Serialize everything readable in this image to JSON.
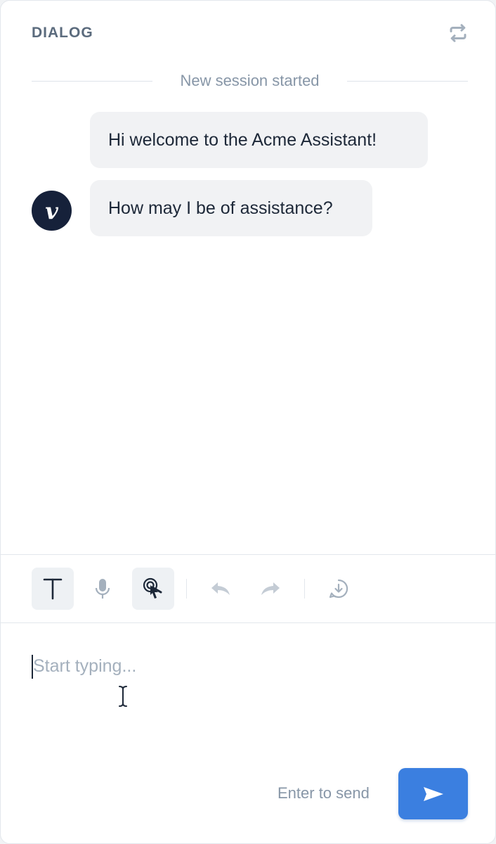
{
  "header": {
    "title": "DIALOG",
    "reset_icon": "refresh-icon"
  },
  "session": {
    "divider_text": "New session started"
  },
  "messages": [
    {
      "text": "Hi welcome to the Acme Assistant!"
    },
    {
      "text": "How may I be of assistance?"
    }
  ],
  "avatar": {
    "letter": "v",
    "color": "#16213a"
  },
  "toolbar": {
    "items": [
      {
        "icon": "text-mode-icon",
        "active": true
      },
      {
        "icon": "microphone-icon",
        "active": false
      },
      {
        "icon": "touch-icon",
        "active": true
      },
      {
        "icon": "undo-icon",
        "active": false
      },
      {
        "icon": "redo-icon",
        "active": false
      },
      {
        "icon": "download-icon",
        "active": false
      }
    ]
  },
  "composer": {
    "placeholder": "Start typing...",
    "hint": "Enter to send",
    "send_icon": "send-icon"
  },
  "colors": {
    "accent": "#3b7fe0",
    "text": "#1d2838",
    "muted": "#8796a7",
    "bubble": "#f1f2f4"
  }
}
